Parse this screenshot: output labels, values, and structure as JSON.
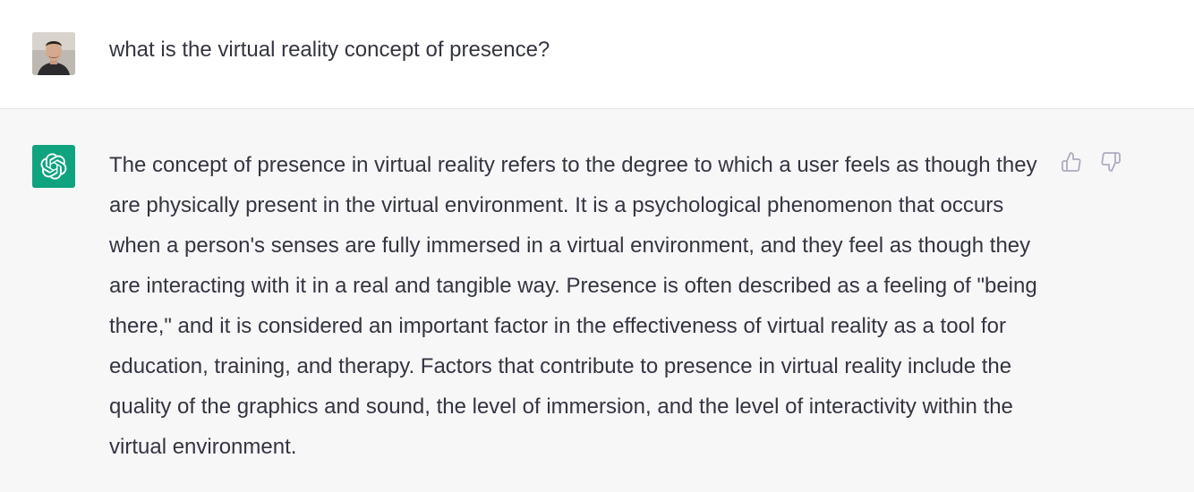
{
  "conversation": {
    "user_message": {
      "text": "what is the virtual reality concept of presence?",
      "avatar": "user-photo-avatar"
    },
    "assistant_message": {
      "avatar": "openai-logo-icon",
      "text": "The concept of presence in virtual reality refers to the degree to which a user feels as though they are physically present in the virtual environment. It is a psychological phenomenon that occurs when a person's senses are fully immersed in a virtual environment, and they feel as though they are interacting with it in a real and tangible way. Presence is often described as a feeling of \"being there,\" and it is considered an important factor in the effectiveness of virtual reality as a tool for education, training, and therapy. Factors that contribute to presence in virtual reality include the quality of the graphics and sound, the level of immersion, and the level of interactivity within the virtual environment."
    },
    "feedback": {
      "thumbs_up_icon": "thumbs-up-icon",
      "thumbs_down_icon": "thumbs-down-icon"
    }
  },
  "colors": {
    "text": "#343541",
    "assistant_bg": "#f7f7f8",
    "brand_green": "#10a37f",
    "icon_gray": "#acacbe"
  }
}
